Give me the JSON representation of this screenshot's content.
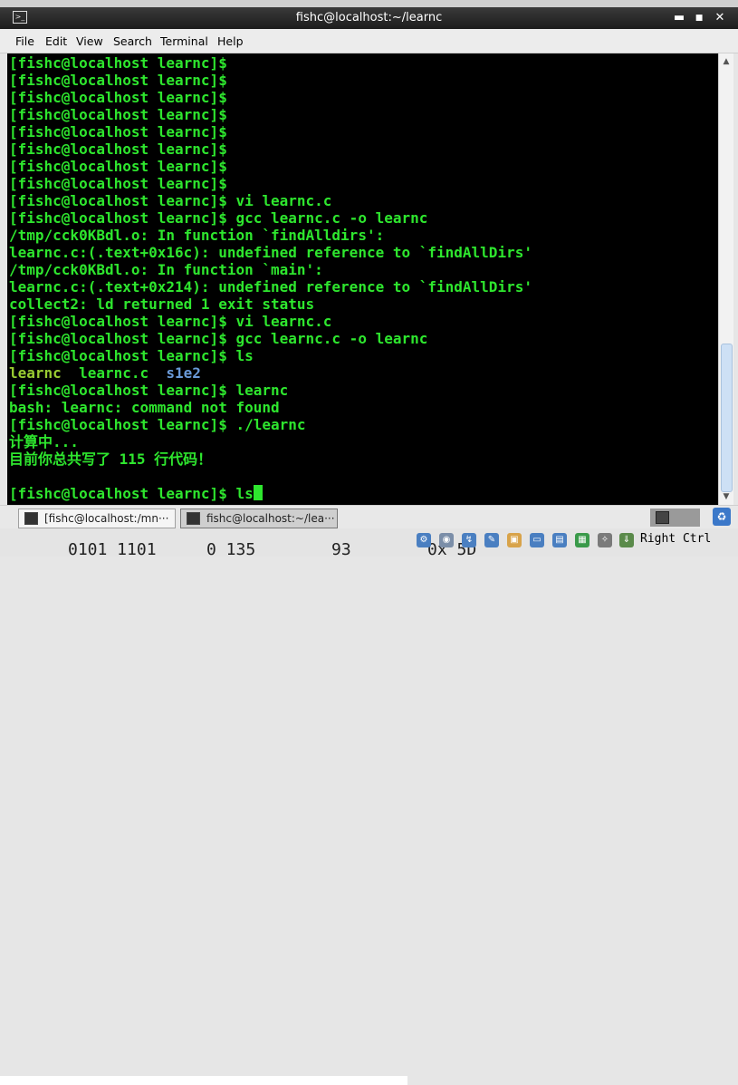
{
  "window": {
    "title": "fishc@localhost:~/learnc"
  },
  "menu": [
    "File",
    "Edit",
    "View",
    "Search",
    "Terminal",
    "Help"
  ],
  "terminal": {
    "prompt": "[fishc@localhost learnc]$",
    "lines": [
      {
        "text": "[fishc@localhost learnc]$"
      },
      {
        "text": "[fishc@localhost learnc]$"
      },
      {
        "text": "[fishc@localhost learnc]$"
      },
      {
        "text": "[fishc@localhost learnc]$"
      },
      {
        "text": "[fishc@localhost learnc]$"
      },
      {
        "text": "[fishc@localhost learnc]$"
      },
      {
        "text": "[fishc@localhost learnc]$"
      },
      {
        "text": "[fishc@localhost learnc]$"
      },
      {
        "text": "[fishc@localhost learnc]$ vi learnc.c"
      },
      {
        "text": "[fishc@localhost learnc]$ gcc learnc.c -o learnc"
      },
      {
        "text": "/tmp/cck0KBdl.o: In function `findAlldirs':"
      },
      {
        "text": "learnc.c:(.text+0x16c): undefined reference to `findAllDirs'"
      },
      {
        "text": "/tmp/cck0KBdl.o: In function `main':"
      },
      {
        "text": "learnc.c:(.text+0x214): undefined reference to `findAllDirs'"
      },
      {
        "text": "collect2: ld returned 1 exit status"
      },
      {
        "text": "[fishc@localhost learnc]$ vi learnc.c"
      },
      {
        "text": "[fishc@localhost learnc]$ gcc learnc.c -o learnc"
      },
      {
        "text": "[fishc@localhost learnc]$ ls"
      },
      {
        "ls": [
          "learnc",
          "learnc.c",
          "s1e2"
        ]
      },
      {
        "text": "[fishc@localhost learnc]$ learnc"
      },
      {
        "text": "bash: learnc: command not found"
      },
      {
        "text": "[fishc@localhost learnc]$ ./learnc"
      },
      {
        "text": "计算中..."
      },
      {
        "text": "目前你总共写了 115 行代码！"
      },
      {
        "text": ""
      },
      {
        "text": "[fishc@localhost learnc]$ ls",
        "cursor": true
      }
    ],
    "colors": {
      "text": "#2ee62e",
      "executable": "#9acd32",
      "directory": "#6a9ad8",
      "background": "#000000"
    }
  },
  "taskbar": {
    "tasks": [
      {
        "label": "[fishc@localhost:/mn···",
        "active": false
      },
      {
        "label": "fishc@localhost:~/lea···",
        "active": true
      }
    ]
  },
  "status": {
    "host_key": "Right Ctrl",
    "background_text": [
      "0101 1101",
      "0 135",
      "93",
      "0x 5D"
    ],
    "icons": [
      "hdd-icon",
      "cd-icon",
      "usb-icon",
      "network-icon",
      "shared-folder-icon",
      "display-icon",
      "capture-icon",
      "cpu-icon",
      "mouse-icon",
      "arrow-down-icon"
    ]
  }
}
